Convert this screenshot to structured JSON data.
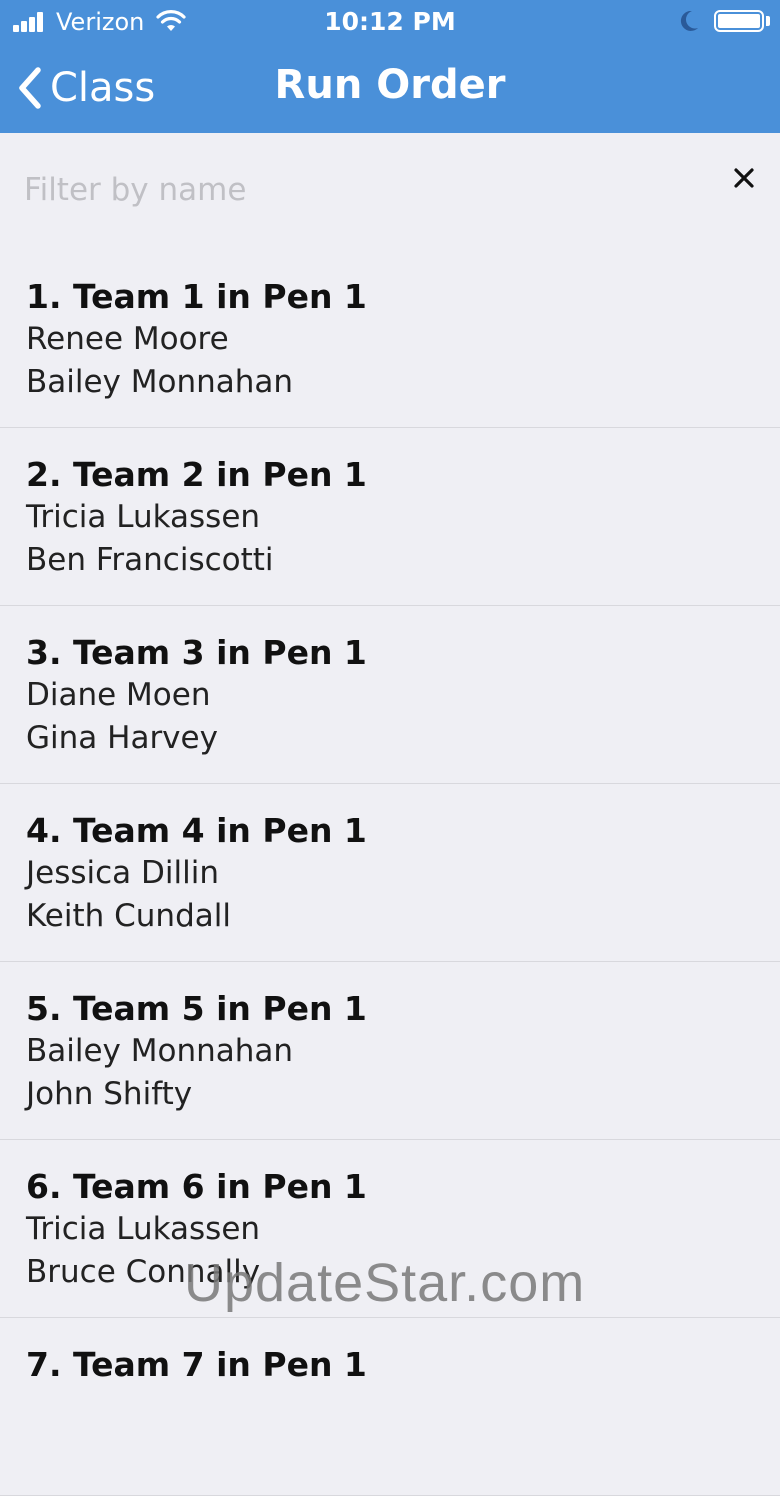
{
  "status_bar": {
    "carrier": "Verizon",
    "time": "10:12 PM"
  },
  "nav": {
    "back_label": "Class",
    "title": "Run Order"
  },
  "filter": {
    "placeholder": "Filter by name",
    "value": ""
  },
  "teams": [
    {
      "title": "1. Team 1 in Pen 1",
      "members": [
        "Renee Moore",
        "Bailey Monnahan"
      ]
    },
    {
      "title": "2. Team 2 in Pen 1",
      "members": [
        "Tricia Lukassen",
        "Ben Franciscotti"
      ]
    },
    {
      "title": "3. Team 3 in Pen 1",
      "members": [
        "Diane Moen",
        "Gina Harvey"
      ]
    },
    {
      "title": "4. Team 4 in Pen 1",
      "members": [
        "Jessica Dillin",
        "Keith Cundall"
      ]
    },
    {
      "title": "5. Team 5 in Pen 1",
      "members": [
        "Bailey Monnahan",
        "John Shifty"
      ]
    },
    {
      "title": "6. Team 6 in Pen 1",
      "members": [
        "Tricia Lukassen",
        "Bruce Connally"
      ]
    },
    {
      "title": "7. Team 7 in Pen 1",
      "members": [
        "",
        ""
      ]
    }
  ],
  "watermark": "UpdateStar.com",
  "colors": {
    "nav_background": "#4a90d9",
    "page_background": "#efeff4"
  }
}
